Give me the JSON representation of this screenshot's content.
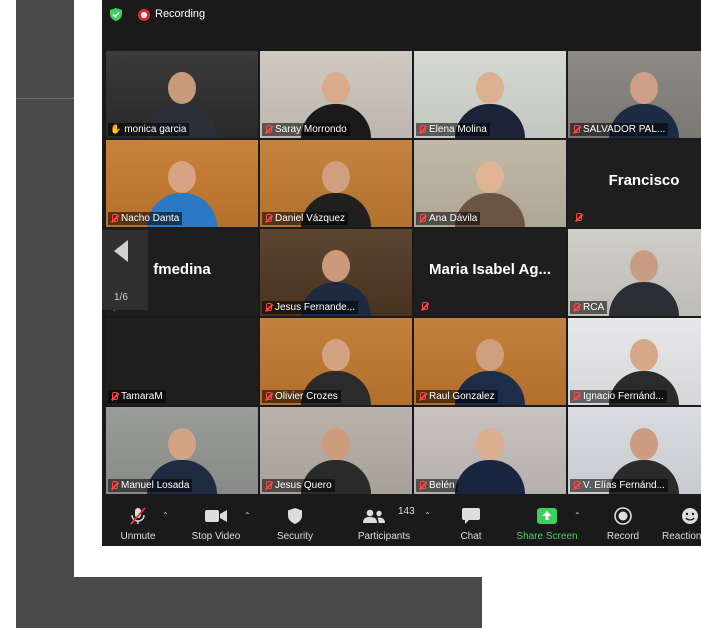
{
  "topbar": {
    "recording_label": "Recording"
  },
  "pager": {
    "page": "1/6"
  },
  "tiles": [
    {
      "name": "monica garcia",
      "bg": "#3b3b3b",
      "skin": "#c99a7c",
      "shirt": "#2a2f3a",
      "active": true,
      "hand": true
    },
    {
      "name": "Saray Morrondo",
      "bg": "#cfc9c2",
      "skin": "#d8ab8c",
      "shirt": "#1a1a1a",
      "active": false,
      "hand": false
    },
    {
      "name": "Elena Molina",
      "bg": "#d6d8d2",
      "skin": "#dcb093",
      "shirt": "#1c2336",
      "active": false,
      "hand": false
    },
    {
      "name": "SALVADOR PAL...",
      "bg": "#8d8a86",
      "skin": "#cfa088",
      "shirt": "#1d2a44",
      "active": false,
      "hand": false
    },
    {
      "name": "Nacho Danta",
      "bg": "#c8823c",
      "skin": "#d6a383",
      "shirt": "#2b78c4",
      "active": false,
      "hand": false
    },
    {
      "name": "Daniel Vázquez",
      "bg": "#c4833f",
      "skin": "#cf9f7f",
      "shirt": "#1f1f1f",
      "active": false,
      "hand": false
    },
    {
      "name": "Ana Dávila",
      "bg": "#c2b8a8",
      "skin": "#dfb494",
      "shirt": "#6b5442",
      "active": false,
      "hand": false
    },
    {
      "name": "Francisco",
      "blank": true
    },
    {
      "name": "fmedina",
      "blank": true
    },
    {
      "name": "Jesus Fernande...",
      "bg": "#5b4532",
      "skin": "#cc9a7a",
      "shirt": "#1e2a3f",
      "active": false,
      "hand": false
    },
    {
      "name": "Maria Isabel Ag...",
      "blank": true
    },
    {
      "name": "RCA",
      "bg": "#d0cec8",
      "skin": "#c89d84",
      "shirt": "#2b2f35",
      "active": false,
      "hand": false
    },
    {
      "name": "TamaraM",
      "blank": true
    },
    {
      "name": "Olivier Crozes",
      "bg": "#c4813d",
      "skin": "#d3a384",
      "shirt": "#2b2b2b",
      "active": false,
      "hand": false
    },
    {
      "name": "Raul Gonzalez",
      "bg": "#c4813d",
      "skin": "#cf9f80",
      "shirt": "#1b2d49",
      "active": false,
      "hand": false
    },
    {
      "name": "Ignacio Fernánd...",
      "bg": "#e8e8ea",
      "skin": "#d7a888",
      "shirt": "#2b2b2b",
      "active": false,
      "hand": false
    },
    {
      "name": "Manuel Losada",
      "bg": "#9a9c99",
      "skin": "#d3a387",
      "shirt": "#1f2b40",
      "active": false,
      "hand": false
    },
    {
      "name": "Jesus Quero",
      "bg": "#b9b3ab",
      "skin": "#cc9c7f",
      "shirt": "#2a2a2a",
      "active": false,
      "hand": false
    },
    {
      "name": "Belén",
      "bg": "#c7c2bf",
      "skin": "#dcae92",
      "shirt": "#1a2640",
      "active": false,
      "hand": false
    },
    {
      "name": "V. Elías Fernánd...",
      "bg": "#d9dce0",
      "skin": "#cc9c82",
      "shirt": "#2a2a2a",
      "active": false,
      "hand": false
    }
  ],
  "blank_names": {
    "francisco": "Francisco",
    "fmedina": "fmedina",
    "maria": "Maria Isabel Ag..."
  },
  "toolbar": {
    "unmute": "Unmute",
    "stop_video": "Stop Video",
    "security": "Security",
    "participants": "Participants",
    "participants_count": "143",
    "chat": "Chat",
    "share_screen": "Share Screen",
    "record": "Record",
    "reactions": "Reactions"
  }
}
